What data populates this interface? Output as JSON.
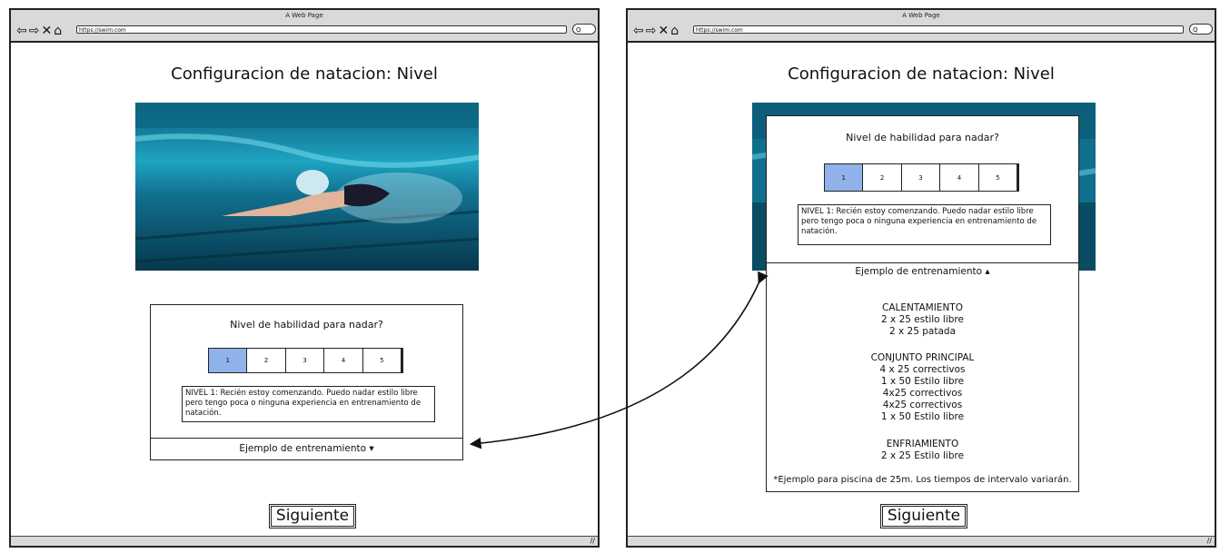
{
  "browser": {
    "title": "A Web Page",
    "url": "https://swim.com",
    "nav_icons": "⇦⇨✕⌂",
    "search_icon": "Q"
  },
  "page": {
    "title": "Configuracion de natacion: Nivel",
    "next_label": "Siguiente"
  },
  "skill": {
    "question": "Nivel de habilidad para nadar?",
    "levels": [
      "1",
      "2",
      "3",
      "4",
      "5"
    ],
    "selected": "1",
    "description": "NIVEL 1: Recién estoy comenzando. Puedo nadar estilo libre pero tengo poca o ninguna experiencia en entrenamiento de natación."
  },
  "example": {
    "collapsed_label": "Ejemplo de entrenamiento ▾",
    "expanded_label": "Ejemplo de entrenamiento ▴",
    "warmup_title": "CALENTAMIENTO",
    "warmup_items": [
      "2 x 25 estilo libre",
      "2 x 25 patada"
    ],
    "main_title": "CONJUNTO PRINCIPAL",
    "main_items": [
      "4 x 25 correctivos",
      "1 x 50 Estilo libre",
      "4x25 correctivos",
      "4x25 correctivos",
      "1 x 50 Estilo libre"
    ],
    "cooldown_title": "ENFRIAMIENTO",
    "cooldown_items": [
      "2 x 25 Estilo libre"
    ],
    "footnote": "*Ejemplo para piscina de 25m. Los tiempos de intervalo variarán."
  },
  "colors": {
    "selected_level": "#8fb2ea",
    "water_dark": "#0b4a63",
    "water_light": "#2ec7e0"
  }
}
